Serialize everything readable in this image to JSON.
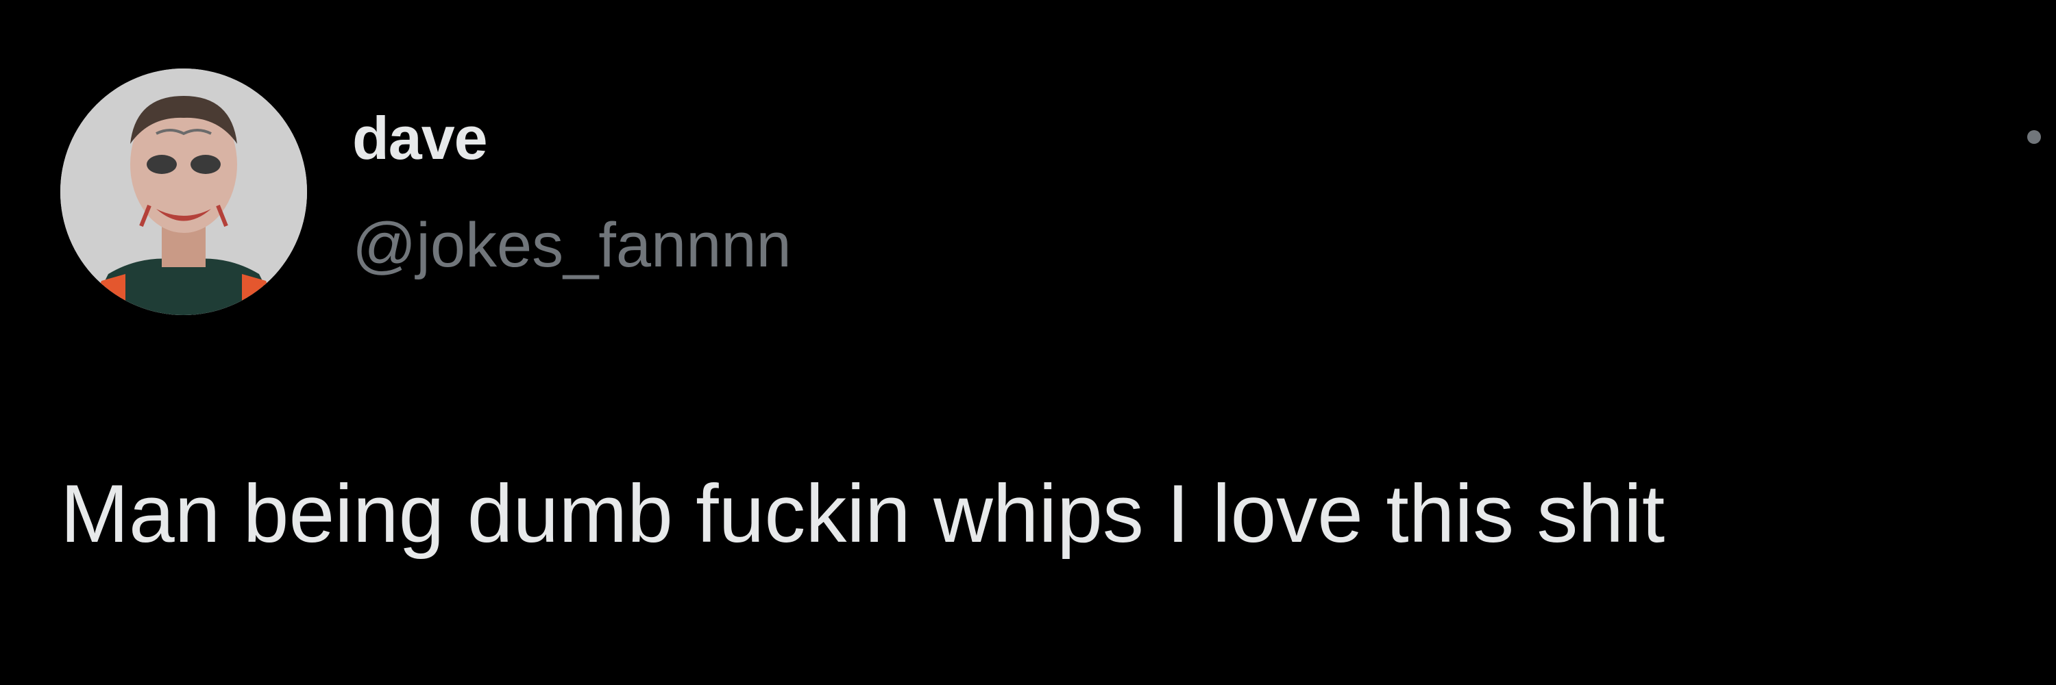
{
  "tweet": {
    "author": {
      "display_name": "dave",
      "handle": "@jokes_fannnn",
      "avatar_icon": "profile-photo-avatar"
    },
    "text": "Man being dumb fuckin whips I love this shit",
    "more_icon": "more-options-icon"
  },
  "colors": {
    "background": "#000000",
    "primary_text": "#e7e9ea",
    "secondary_text": "#71767b"
  }
}
